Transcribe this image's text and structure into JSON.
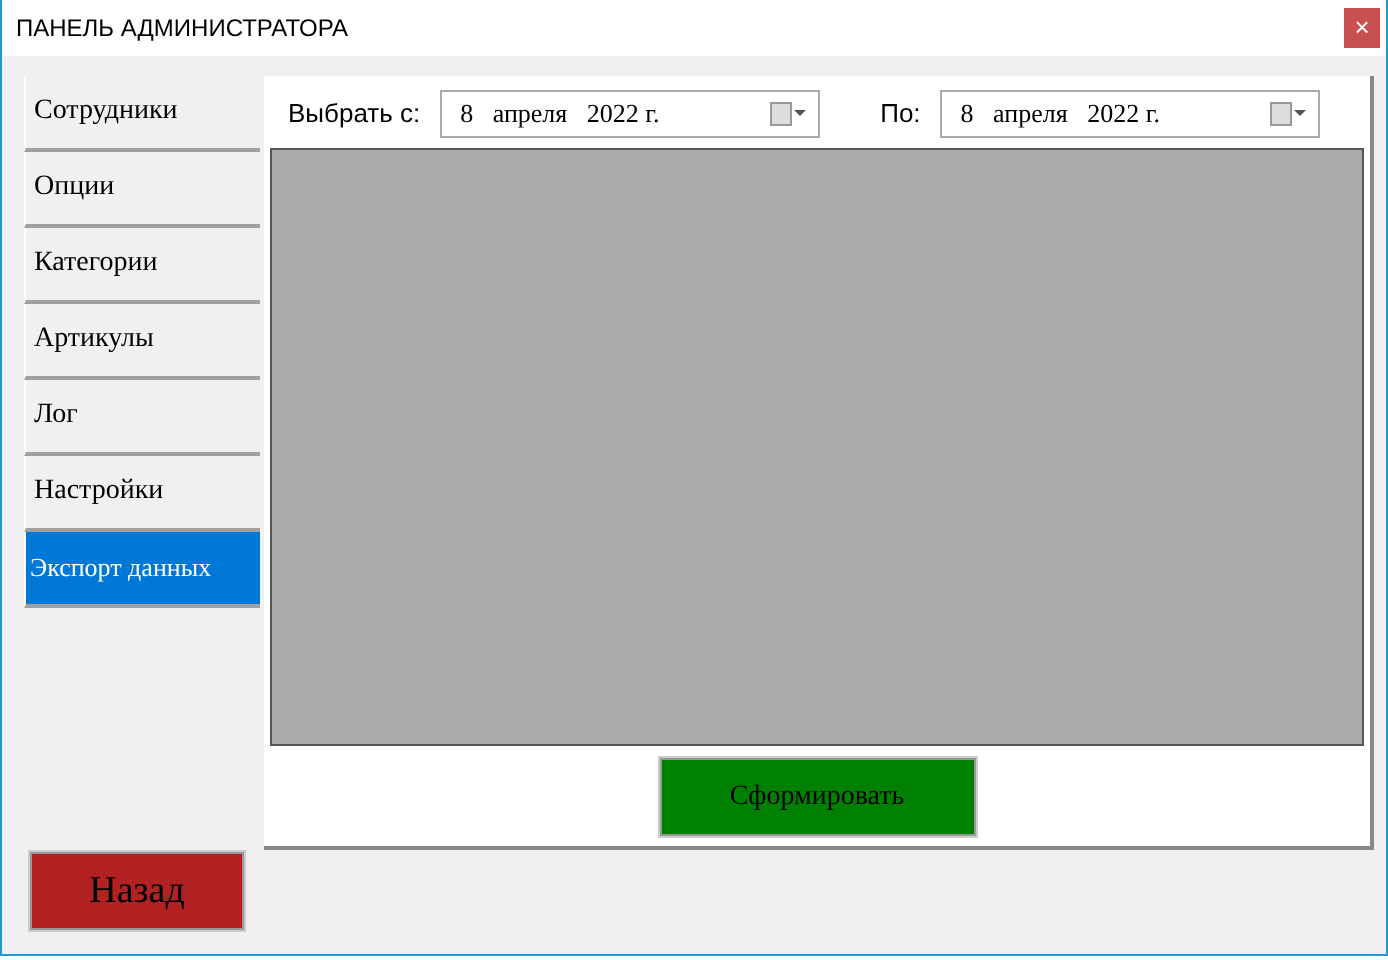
{
  "window": {
    "title": "ПАНЕЛЬ АДМИНИСТРАТОРА",
    "close": "×"
  },
  "sidebar": {
    "items": [
      {
        "label": "Сотрудники",
        "selected": false
      },
      {
        "label": "Опции",
        "selected": false
      },
      {
        "label": "Категории",
        "selected": false
      },
      {
        "label": "Артикулы",
        "selected": false
      },
      {
        "label": "Лог",
        "selected": false
      },
      {
        "label": "Настройки",
        "selected": false
      },
      {
        "label": "Экспорт данных",
        "selected": true
      }
    ]
  },
  "filters": [
    {
      "label": "Выбрать с:",
      "value": "8   апреля   2022 г."
    },
    {
      "label": "По:",
      "value": "8   апреля   2022 г."
    }
  ],
  "generate_button": "Сформировать",
  "back_button": "Назад"
}
